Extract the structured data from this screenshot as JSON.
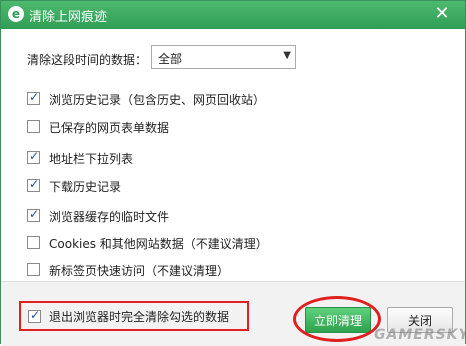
{
  "titlebar": {
    "icon_glyph": "e",
    "title": "清除上网痕迹",
    "close_glyph": "✕"
  },
  "range": {
    "label": "清除这段时间的数据：",
    "selected": "全部",
    "arrow_glyph": "▼"
  },
  "options": [
    {
      "label": "浏览历史记录（包含历史、网页回收站）",
      "checked": true
    },
    {
      "label": "已保存的网页表单数据",
      "checked": false
    },
    {
      "label": "地址栏下拉列表",
      "checked": true
    },
    {
      "label": "下载历史记录",
      "checked": true
    },
    {
      "label": "浏览器缓存的临时文件",
      "checked": true
    },
    {
      "label": "Cookies 和其他网站数据（不建议清理）",
      "checked": false
    },
    {
      "label": "新标签页快速访问（不建议清理）",
      "checked": false
    }
  ],
  "footer": {
    "exit_option": {
      "label": "退出浏览器时完全清除勾选的数据",
      "checked": true
    },
    "clear_button": "立即清理",
    "close_button": "关闭"
  },
  "watermark": "GAMERSKY",
  "colors": {
    "titlebar": "#3aa95e",
    "primary_button": "#2ea14e",
    "annotation": "#e02020"
  }
}
